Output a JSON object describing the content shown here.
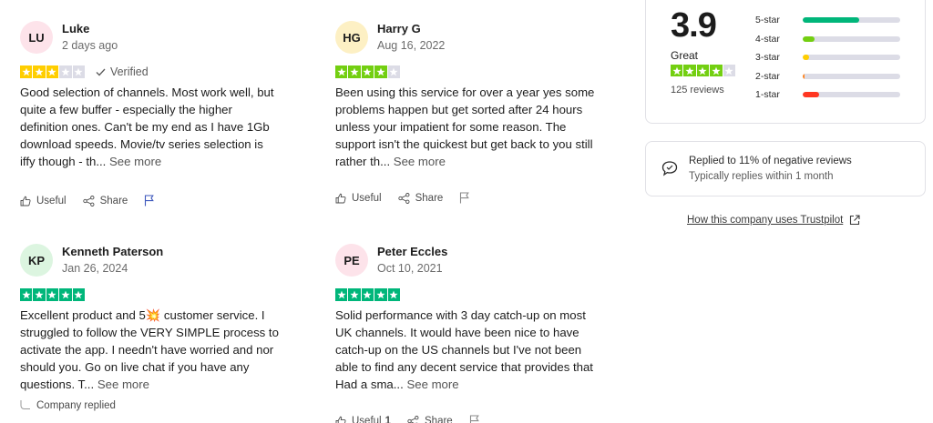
{
  "reviews": [
    {
      "initials": "LU",
      "avatar_color": "#fde3ea",
      "name": "Luke",
      "date": "2 days ago",
      "rating": 3,
      "star_color": "#ffce00",
      "verified": "Verified",
      "text": "Good selection of channels. Most work well, but quite a few buffer - especially the higher definition ones. Can't be my end as I have 1Gb download speeds. Movie/tv series selection is iffy though - th...",
      "see_more": "See more",
      "useful": "Useful",
      "share": "Share",
      "flag_color": "#3c57bc"
    },
    {
      "initials": "HG",
      "avatar_color": "#fdf0c4",
      "name": "Harry G",
      "date": "Aug 16, 2022",
      "rating": 4,
      "star_color": "#73cf11",
      "text": "Been using this service for over a year yes some problems happen but get sorted after 24 hours unless your impatient for some reason. The support isn't the quickest but get back to you still rather th...",
      "see_more": "See more",
      "useful": "Useful",
      "share": "Share",
      "flag_color": "#8a8a8a"
    },
    {
      "initials": "KP",
      "avatar_color": "#dcf5e0",
      "name": "Kenneth Paterson",
      "date": "Jan 26, 2024",
      "rating": 5,
      "star_color": "#00b67a",
      "text": "Excellent product and 5💥 customer service. I struggled to follow the VERY SIMPLE process to activate the app. I needn't have worried and nor should you. Go on live chat if you have any questions. T...",
      "see_more": "See more",
      "company_replied": "Company replied"
    },
    {
      "initials": "PE",
      "avatar_color": "#fde3ea",
      "name": "Peter Eccles",
      "date": "Oct 10, 2021",
      "rating": 5,
      "star_color": "#00b67a",
      "text": "Solid performance with 3 day catch-up on most UK channels. It would have been nice to have catch-up on the US channels but I've not been able to find any decent service that provides that Had a sma...",
      "see_more": "See more",
      "useful": "Useful",
      "useful_count": "1",
      "share": "Share"
    }
  ],
  "summary": {
    "score": "3.9",
    "label": "Great",
    "rating": 4,
    "star_color": "#73cf11",
    "count": "125 reviews",
    "distribution": [
      {
        "label": "5-star",
        "fraction": 0.58,
        "color": "#00b67a"
      },
      {
        "label": "4-star",
        "fraction": 0.12,
        "color": "#73cf11"
      },
      {
        "label": "3-star",
        "fraction": 0.07,
        "color": "#ffce00"
      },
      {
        "label": "2-star",
        "fraction": 0.02,
        "color": "#ff8622"
      },
      {
        "label": "1-star",
        "fraction": 0.17,
        "color": "#ff3722"
      }
    ]
  },
  "reply_stats": {
    "line1": "Replied to 11% of negative reviews",
    "line2": "Typically replies within 1 month"
  },
  "trustpilot_link": "How this company uses Trustpilot",
  "icons": {
    "thumb": "thumbs-up-icon",
    "share": "share-icon",
    "flag": "flag-icon",
    "verified": "check-icon",
    "reply": "chat-bubble-icon",
    "external": "external-link-icon"
  }
}
